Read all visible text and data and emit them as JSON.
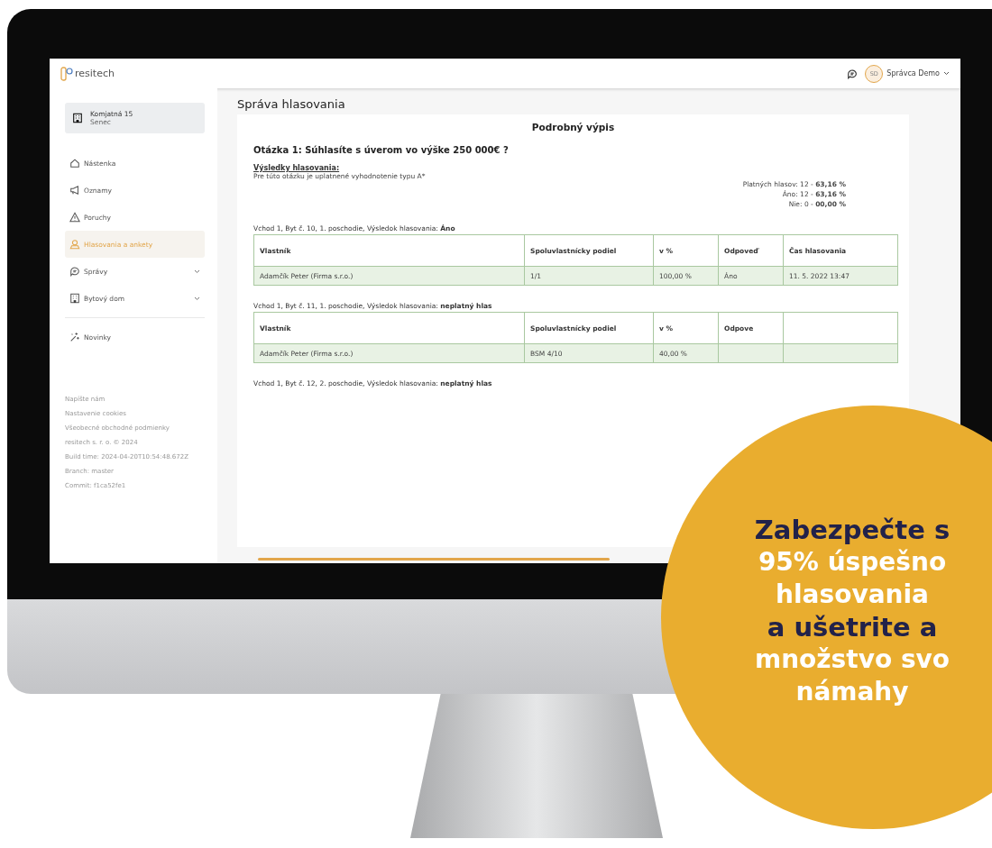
{
  "header": {
    "logo": "resitech",
    "avatar": "SD",
    "user": "Správca Demo"
  },
  "sidebar": {
    "building": {
      "name": "Komjatná 15",
      "city": "Senec"
    },
    "items": [
      {
        "label": "Nástenka",
        "kind": "home",
        "selected": false,
        "expandable": false
      },
      {
        "label": "Oznamy",
        "kind": "megaphone",
        "selected": false,
        "expandable": false
      },
      {
        "label": "Poruchy",
        "kind": "warning",
        "selected": false,
        "expandable": false
      },
      {
        "label": "Hlasovania a ankety",
        "kind": "vote",
        "selected": true,
        "expandable": false
      },
      {
        "label": "Správy",
        "kind": "chat",
        "selected": false,
        "expandable": true
      },
      {
        "label": "Bytový dom",
        "kind": "building",
        "selected": false,
        "expandable": true
      }
    ],
    "extra_items": [
      {
        "label": "Novinky",
        "kind": "sparkle",
        "selected": false,
        "expandable": false
      }
    ],
    "footer_links": [
      "Napíšte nám",
      "Nastavenie cookies",
      "Všeobecné obchodné podmienky"
    ],
    "meta": [
      "resitech s. r. o. © 2024",
      "Build time: 2024-04-20T10:54:48.672Z",
      "Branch: master",
      "Commit: f1ca52fe1"
    ]
  },
  "page_title": "Správa hlasovania",
  "report": {
    "title": "Podrobný výpis",
    "question": "Otázka 1: Súhlasíte s úverom vo výške 250 000€ ?",
    "results_heading": "Výsledky hlasovania:",
    "note": "Pre túto otázku je uplatnené vyhodnotenie typu A*",
    "totals": [
      {
        "label": "Platných hlasov: 12 - ",
        "value": "63,16 %"
      },
      {
        "label": "Áno: 12 - ",
        "value": "63,16 %"
      },
      {
        "label": "Nie: 0 - ",
        "value": "00,00 %"
      }
    ],
    "units": [
      {
        "caption": "Vchod 1, Byt č. 10, 1. poschodie, Výsledok hlasovania: **Áno**",
        "columns": [
          "Vlastník",
          "Spoluvlastnícky podiel",
          "v %",
          "Odpoveď",
          "Čas hlasovania"
        ],
        "rows": [
          [
            "Adamčík Peter (Firma s.r.o.)",
            "1/1",
            "100,00 %",
            "Áno",
            "11. 5. 2022 13:47"
          ]
        ]
      },
      {
        "caption": "Vchod 1, Byt č. 11, 1. poschodie, Výsledok hlasovania: **neplatný hlas**",
        "columns": [
          "Vlastník",
          "Spoluvlastnícky podiel",
          "v %",
          "Odpove"
        ],
        "rows": [
          [
            "Adamčík Peter (Firma s.r.o.)",
            "BSM 4/10",
            "40,00 %"
          ]
        ]
      },
      {
        "caption": "Vchod 1, Byt č. 12, 2. poschodie, Výsledok hlasovania: **neplatný hlas**"
      }
    ]
  },
  "promo": {
    "lines": [
      {
        "text": "Zabezpečte s",
        "kind": "dark"
      },
      {
        "text": "95% úspešno",
        "kind": "light"
      },
      {
        "text": "hlasovania",
        "kind": "light"
      },
      {
        "text": "a ušetrite a",
        "kind": "dark"
      },
      {
        "text": "množstvo svo",
        "kind": "light"
      },
      {
        "text": "námahy",
        "kind": "light"
      }
    ]
  }
}
